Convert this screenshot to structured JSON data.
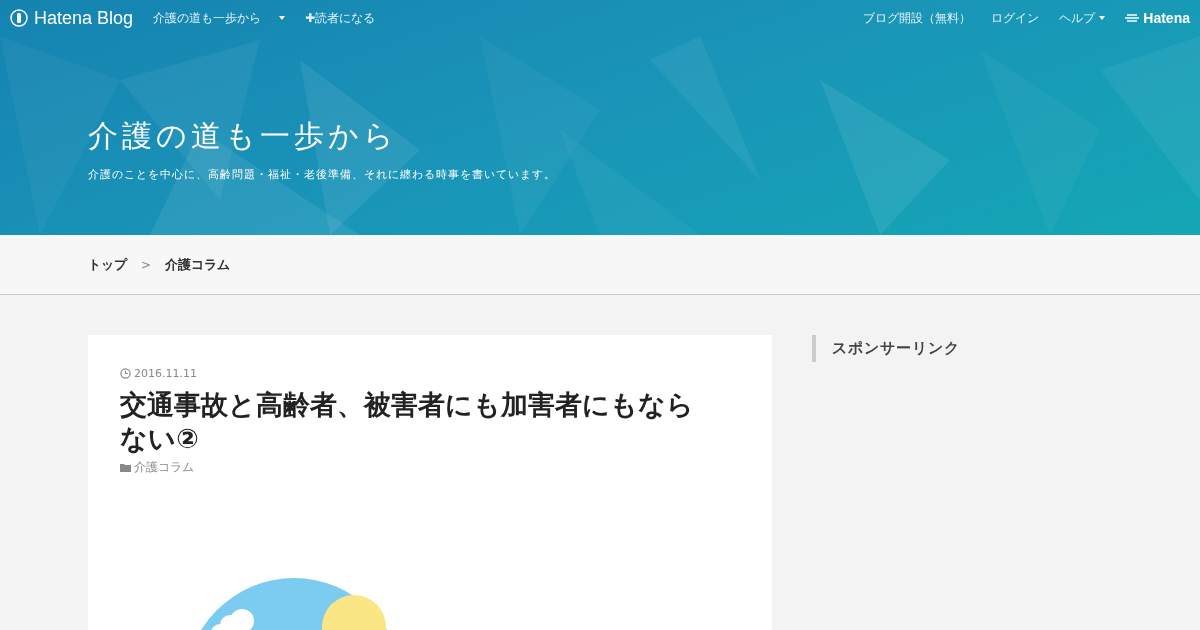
{
  "topbar": {
    "logo": "Hatena Blog",
    "blog_menu": "介護の道も一歩から",
    "subscribe": "✚読者になる",
    "links": [
      "ブログ開設（無料）",
      "ログイン"
    ],
    "help": "ヘルプ",
    "brand": "Hatena"
  },
  "header": {
    "title": "介護の道も一歩から",
    "description": "介護のことを中心に、高齢問題・福祉・老後準備、それに纏わる時事を書いています。"
  },
  "breadcrumb": [
    "トップ",
    "介護コラム"
  ],
  "breadcrumb_separator": ">",
  "article": {
    "date": "2016.11.11",
    "title": "交通事故と高齢者、被害者にも加害者にもならない②",
    "category": "介護コラム"
  },
  "sidebar": {
    "heading": "スポンサーリンク"
  }
}
